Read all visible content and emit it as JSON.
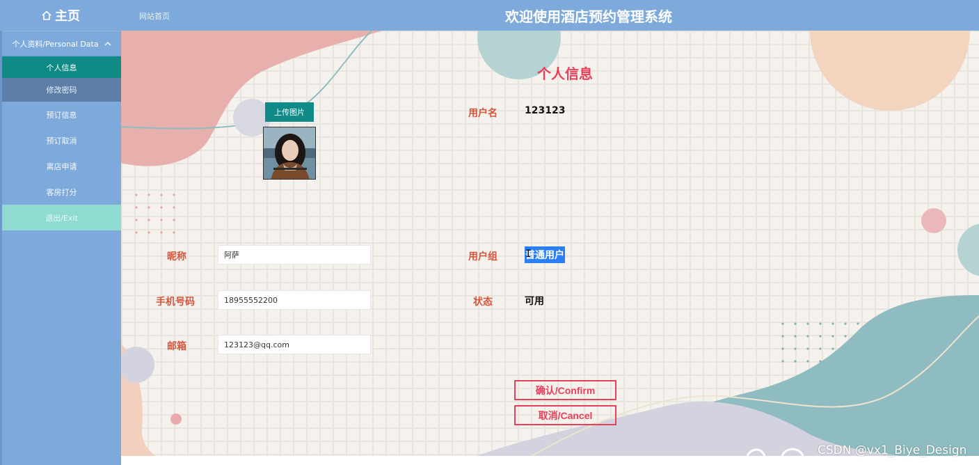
{
  "header": {
    "home_label": "主页",
    "breadcrumb": "网站首页",
    "system_title": "欢迎使用酒店预约管理系统"
  },
  "sidebar": {
    "group_label": "个人资料/Personal Data",
    "items": [
      {
        "label": "个人信息",
        "state": "active"
      },
      {
        "label": "修改密码",
        "state": "hover"
      },
      {
        "label": "预订信息",
        "state": "normal"
      },
      {
        "label": "预订取消",
        "state": "normal"
      },
      {
        "label": "离店申请",
        "state": "normal"
      },
      {
        "label": "客房打分",
        "state": "normal"
      },
      {
        "label": "退出/Exit",
        "state": "exit"
      }
    ]
  },
  "form": {
    "title": "个人信息",
    "upload_label": "上传图片",
    "username_label": "用户名",
    "username_value": "123123",
    "nickname_label": "昵称",
    "nickname_value": "阿萨",
    "group_label": "用户组",
    "group_value": "普通用户",
    "phone_label": "手机号码",
    "phone_value": "18955552200",
    "status_label": "状态",
    "status_value": "可用",
    "email_label": "邮箱",
    "email_value": "123123@qq.com",
    "confirm_label": "确认/Confirm",
    "cancel_label": "取消/Cancel"
  },
  "watermark": "CSDN @vx1_Biye_Design",
  "colors": {
    "header_bg": "#7eaadb",
    "accent_teal": "#0f8a87",
    "accent_red": "#e8405a",
    "label_orange": "#d4563c"
  }
}
